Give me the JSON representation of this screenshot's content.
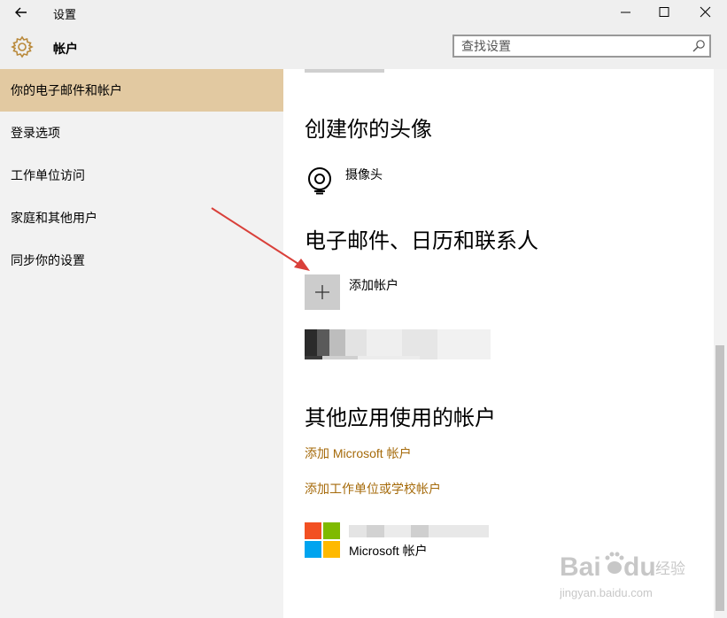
{
  "titlebar": {
    "back_icon": "back-arrow-icon",
    "title": "设置",
    "window_controls": [
      "minimize-icon",
      "maximize-icon",
      "close-icon"
    ]
  },
  "header": {
    "icon": "gear-icon",
    "title": "帐户",
    "search": {
      "placeholder": "查找设置",
      "value": ""
    }
  },
  "sidebar": {
    "items": [
      {
        "label": "你的电子邮件和帐户",
        "active": true
      },
      {
        "label": "登录选项",
        "active": false
      },
      {
        "label": "工作单位访问",
        "active": false
      },
      {
        "label": "家庭和其他用户",
        "active": false
      },
      {
        "label": "同步你的设置",
        "active": false
      }
    ]
  },
  "content": {
    "avatar_section": {
      "heading": "创建你的头像",
      "camera_label": "摄像头"
    },
    "email_section": {
      "heading": "电子邮件、日历和联系人",
      "add_account_label": "添加帐户"
    },
    "other_apps_section": {
      "heading": "其他应用使用的帐户",
      "add_microsoft_link": "添加 Microsoft 帐户",
      "add_work_link": "添加工作单位或学校帐户",
      "account_type_label": "Microsoft 帐户"
    }
  },
  "watermark": {
    "brand": "Baidu 经验",
    "url": "jingyan.baidu.com"
  },
  "colors": {
    "accent": "#a56a0a",
    "active_item": "#e2c9a1",
    "sidebar_bg": "#f2f2f2",
    "arrow": "#d9403a",
    "ms_red": "#f25022",
    "ms_green": "#7fba00",
    "ms_blue": "#00a4ef",
    "ms_yellow": "#ffb900"
  }
}
